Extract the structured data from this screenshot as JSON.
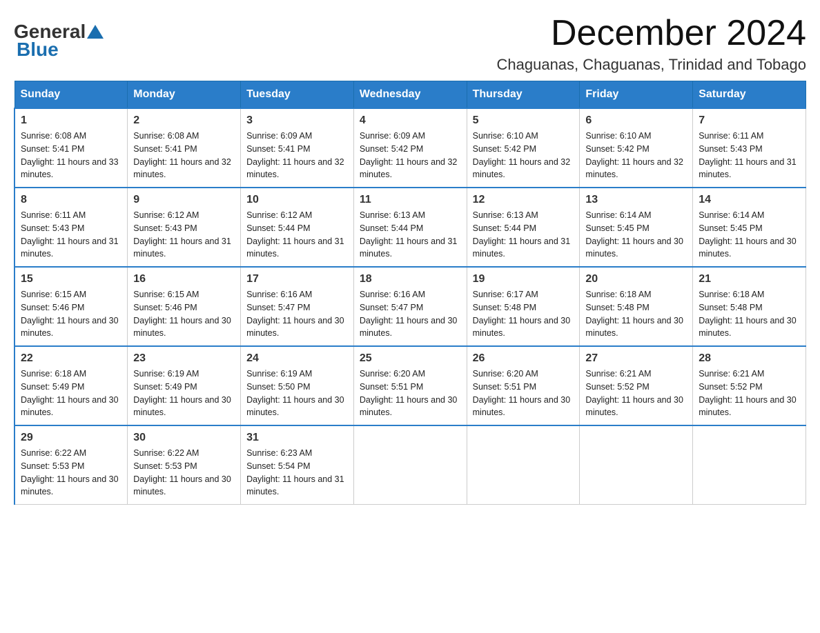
{
  "header": {
    "logo_general": "General",
    "logo_blue": "Blue",
    "month_title": "December 2024",
    "location": "Chaguanas, Chaguanas, Trinidad and Tobago"
  },
  "weekdays": [
    "Sunday",
    "Monday",
    "Tuesday",
    "Wednesday",
    "Thursday",
    "Friday",
    "Saturday"
  ],
  "weeks": [
    [
      {
        "day": "1",
        "sunrise": "6:08 AM",
        "sunset": "5:41 PM",
        "daylight": "11 hours and 33 minutes."
      },
      {
        "day": "2",
        "sunrise": "6:08 AM",
        "sunset": "5:41 PM",
        "daylight": "11 hours and 32 minutes."
      },
      {
        "day": "3",
        "sunrise": "6:09 AM",
        "sunset": "5:41 PM",
        "daylight": "11 hours and 32 minutes."
      },
      {
        "day": "4",
        "sunrise": "6:09 AM",
        "sunset": "5:42 PM",
        "daylight": "11 hours and 32 minutes."
      },
      {
        "day": "5",
        "sunrise": "6:10 AM",
        "sunset": "5:42 PM",
        "daylight": "11 hours and 32 minutes."
      },
      {
        "day": "6",
        "sunrise": "6:10 AM",
        "sunset": "5:42 PM",
        "daylight": "11 hours and 32 minutes."
      },
      {
        "day": "7",
        "sunrise": "6:11 AM",
        "sunset": "5:43 PM",
        "daylight": "11 hours and 31 minutes."
      }
    ],
    [
      {
        "day": "8",
        "sunrise": "6:11 AM",
        "sunset": "5:43 PM",
        "daylight": "11 hours and 31 minutes."
      },
      {
        "day": "9",
        "sunrise": "6:12 AM",
        "sunset": "5:43 PM",
        "daylight": "11 hours and 31 minutes."
      },
      {
        "day": "10",
        "sunrise": "6:12 AM",
        "sunset": "5:44 PM",
        "daylight": "11 hours and 31 minutes."
      },
      {
        "day": "11",
        "sunrise": "6:13 AM",
        "sunset": "5:44 PM",
        "daylight": "11 hours and 31 minutes."
      },
      {
        "day": "12",
        "sunrise": "6:13 AM",
        "sunset": "5:44 PM",
        "daylight": "11 hours and 31 minutes."
      },
      {
        "day": "13",
        "sunrise": "6:14 AM",
        "sunset": "5:45 PM",
        "daylight": "11 hours and 30 minutes."
      },
      {
        "day": "14",
        "sunrise": "6:14 AM",
        "sunset": "5:45 PM",
        "daylight": "11 hours and 30 minutes."
      }
    ],
    [
      {
        "day": "15",
        "sunrise": "6:15 AM",
        "sunset": "5:46 PM",
        "daylight": "11 hours and 30 minutes."
      },
      {
        "day": "16",
        "sunrise": "6:15 AM",
        "sunset": "5:46 PM",
        "daylight": "11 hours and 30 minutes."
      },
      {
        "day": "17",
        "sunrise": "6:16 AM",
        "sunset": "5:47 PM",
        "daylight": "11 hours and 30 minutes."
      },
      {
        "day": "18",
        "sunrise": "6:16 AM",
        "sunset": "5:47 PM",
        "daylight": "11 hours and 30 minutes."
      },
      {
        "day": "19",
        "sunrise": "6:17 AM",
        "sunset": "5:48 PM",
        "daylight": "11 hours and 30 minutes."
      },
      {
        "day": "20",
        "sunrise": "6:18 AM",
        "sunset": "5:48 PM",
        "daylight": "11 hours and 30 minutes."
      },
      {
        "day": "21",
        "sunrise": "6:18 AM",
        "sunset": "5:48 PM",
        "daylight": "11 hours and 30 minutes."
      }
    ],
    [
      {
        "day": "22",
        "sunrise": "6:18 AM",
        "sunset": "5:49 PM",
        "daylight": "11 hours and 30 minutes."
      },
      {
        "day": "23",
        "sunrise": "6:19 AM",
        "sunset": "5:49 PM",
        "daylight": "11 hours and 30 minutes."
      },
      {
        "day": "24",
        "sunrise": "6:19 AM",
        "sunset": "5:50 PM",
        "daylight": "11 hours and 30 minutes."
      },
      {
        "day": "25",
        "sunrise": "6:20 AM",
        "sunset": "5:51 PM",
        "daylight": "11 hours and 30 minutes."
      },
      {
        "day": "26",
        "sunrise": "6:20 AM",
        "sunset": "5:51 PM",
        "daylight": "11 hours and 30 minutes."
      },
      {
        "day": "27",
        "sunrise": "6:21 AM",
        "sunset": "5:52 PM",
        "daylight": "11 hours and 30 minutes."
      },
      {
        "day": "28",
        "sunrise": "6:21 AM",
        "sunset": "5:52 PM",
        "daylight": "11 hours and 30 minutes."
      }
    ],
    [
      {
        "day": "29",
        "sunrise": "6:22 AM",
        "sunset": "5:53 PM",
        "daylight": "11 hours and 30 minutes."
      },
      {
        "day": "30",
        "sunrise": "6:22 AM",
        "sunset": "5:53 PM",
        "daylight": "11 hours and 30 minutes."
      },
      {
        "day": "31",
        "sunrise": "6:23 AM",
        "sunset": "5:54 PM",
        "daylight": "11 hours and 31 minutes."
      },
      null,
      null,
      null,
      null
    ]
  ]
}
